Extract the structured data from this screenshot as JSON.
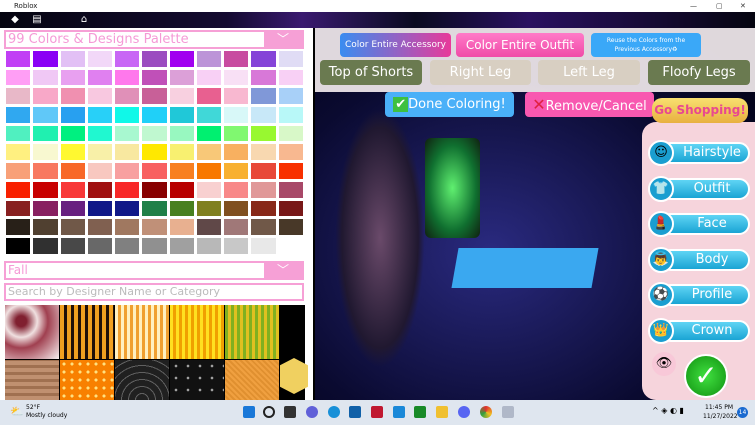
{
  "window": {
    "title": "Roblox",
    "controls": [
      "—",
      "▢",
      "✕"
    ]
  },
  "topbar": {
    "icons": [
      "roblox-logo-icon",
      "chat-icon",
      "backpack-icon"
    ]
  },
  "palette": {
    "title": "99 Colors & Designs Palette",
    "colors": [
      "#c13ff5",
      "#8a00f5",
      "#e2c0f5",
      "#f2d8f8",
      "#c866f5",
      "#9b4cc0",
      "#a100f0",
      "#bc94d8",
      "#c84ca0",
      "#8544d8",
      "#e0dcf5",
      "#ff9ef5",
      "#f0c8f5",
      "#e8a0f0",
      "#e080f0",
      "#ff78ec",
      "#c050b8",
      "#dca0d8",
      "#f8d0f5",
      "#f8e0f5",
      "#d878d8",
      "#f8d0f5",
      "#e8b8c8",
      "#f8a8c8",
      "#f090b0",
      "#f8c8e0",
      "#e090b8",
      "#c86098",
      "#f8d0e0",
      "#e86090",
      "#f8b8d0",
      "#8098d8",
      "#a8d0f8",
      "#30a8f0",
      "#60c8f8",
      "#28a0f0",
      "#28d0f8",
      "#10f8e8",
      "#20d0f8",
      "#20c8d8",
      "#40d8d8",
      "#d8f8f8",
      "#c8e8f8",
      "#b8f8f8",
      "#50f0c0",
      "#20f0b0",
      "#00f080",
      "#20f8d0",
      "#a8f8d0",
      "#c0f8d0",
      "#98f8c0",
      "#00f070",
      "#80f870",
      "#98f830",
      "#d8f8c8",
      "#fff080",
      "#f8f8d0",
      "#fff830",
      "#f8f0a8",
      "#f8e8a0",
      "#ffe800",
      "#f8f070",
      "#f8c878",
      "#f8b060",
      "#f8d8b0",
      "#f8b890",
      "#f8a078",
      "#f87860",
      "#f86828",
      "#f8c8c0",
      "#f8a0a0",
      "#f86060",
      "#f88020",
      "#f87800",
      "#f8b030",
      "#e84838",
      "#f83000",
      "#f82000",
      "#c80000",
      "#f83838",
      "#a01010",
      "#f82828",
      "#880000",
      "#b80000",
      "#f8d0d0",
      "#f88888",
      "#e09898",
      "#a84868",
      "#882020",
      "#882060",
      "#682080",
      "#101888",
      "#101888",
      "#208048",
      "#488020",
      "#808020",
      "#805020",
      "#882818",
      "#781818",
      "#282018",
      "#504030",
      "#705848",
      "#806050",
      "#a07860",
      "#c09078",
      "#e8b090",
      "#604848",
      "#a07878",
      "#705848",
      "#483828",
      "#000000",
      "#303030",
      "#484848",
      "#686868",
      "#808080",
      "#909090",
      "#a0a0a0",
      "#b8b8b8",
      "#c8c8c8",
      "#e8e8e8",
      "#ffffff"
    ]
  },
  "category": {
    "selected": "Fall",
    "search_placeholder": "Search by Designer Name or Category"
  },
  "textures": [
    "blood-splatter",
    "orange-black-stripes",
    "cream-orange-stripes",
    "yellow-orange-stripes",
    "green-yellow-stripes",
    "tan-stripes",
    "orange-dots",
    "spider-web-dark",
    "spider-web-stars",
    "orange-weave"
  ],
  "coloring": {
    "color_accessory": "Color Entire Accessory",
    "color_outfit": "Color Entire Outfit",
    "reuse": "Reuse the Colors from the Previous Accessory♻",
    "parts": [
      "Top of Shorts",
      "Right Leg",
      "Left Leg",
      "Floofy Legs"
    ],
    "done": "Done Coloring!",
    "remove": "Remove/Cancel",
    "shop": "Go Shopping!"
  },
  "menu": [
    {
      "label": "Hairstyle",
      "icon": "hair-icon"
    },
    {
      "label": "Outfit",
      "icon": "shirt-icon"
    },
    {
      "label": "Face",
      "icon": "lipstick-icon"
    },
    {
      "label": "Body",
      "icon": "body-icon"
    },
    {
      "label": "Profile",
      "icon": "soccer-ball-icon"
    },
    {
      "label": "Crown",
      "icon": "crown-icon"
    }
  ],
  "taskbar": {
    "temp": "52°F",
    "weather": "Mostly cloudy",
    "time": "11:45 PM",
    "date": "11/27/2022",
    "badge": "14"
  }
}
